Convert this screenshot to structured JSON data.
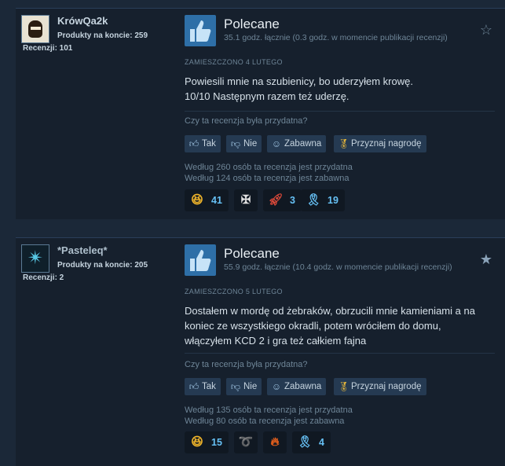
{
  "reviews": [
    {
      "author": {
        "name": "KrówQa2k",
        "products": "Produkty na koncie: 259",
        "reviews": "Recenzji: 101"
      },
      "verdict": "Polecane",
      "hours": "35.1 godz. łącznie (0.3 godz. w momencie publikacji recenzji)",
      "posted": "ZAMIESZCZONO 4 LUTEGO",
      "text_lines": [
        "Powiesili mnie na szubienicy, bo uderzyłem krowę.",
        "10/10 Następnym razem też uderzę."
      ],
      "helpful_question": "Czy ta recenzja była przydatna?",
      "buttons": {
        "yes": "Tak",
        "no": "Nie",
        "funny": "Zabawna",
        "award": "Przyznaj nagrodę"
      },
      "stats": [
        "Według 260 osób ta recenzja jest przydatna",
        "Według 124 osób ta recenzja jest zabawna"
      ],
      "reactions": [
        {
          "icon": "laughing-face-icon",
          "count": "41"
        },
        {
          "icon": "winged-emblem-icon",
          "count": ""
        },
        {
          "icon": "rocket-icon",
          "count": "3"
        },
        {
          "icon": "ribbon-medal-icon",
          "count": "19"
        }
      ]
    },
    {
      "author": {
        "name": "*Pasteleq*",
        "products": "Produkty na koncie: 205",
        "reviews": "Recenzji: 2"
      },
      "verdict": "Polecane",
      "hours": "55.9 godz. łącznie (10.4 godz. w momencie publikacji recenzji)",
      "posted": "ZAMIESZCZONO 5 LUTEGO",
      "text_lines": [
        "Dostałem w mordę od żebraków, obrzucili mnie kamieniami a na",
        "koniec ze wszystkiego okradli, potem wróciłem do domu,",
        "włączyłem KCD 2 i gra też całkiem fajna"
      ],
      "helpful_question": "Czy ta recenzja była przydatna?",
      "buttons": {
        "yes": "Tak",
        "no": "Nie",
        "funny": "Zabawna",
        "award": "Przyznaj nagrodę"
      },
      "stats": [
        "Według 135 osób ta recenzja jest przydatna",
        "Według 80 osób ta recenzja jest zabawna"
      ],
      "reactions": [
        {
          "icon": "laughing-face-icon",
          "count": "15"
        },
        {
          "icon": "banana-icon",
          "count": ""
        },
        {
          "icon": "fire-creature-icon",
          "count": ""
        },
        {
          "icon": "ribbon-medal-icon",
          "count": "4"
        }
      ]
    }
  ],
  "colors": {
    "background": "#1b2838",
    "panel": "#16202d",
    "accent": "#66c0f4",
    "thumb": "#2e6fa7"
  }
}
